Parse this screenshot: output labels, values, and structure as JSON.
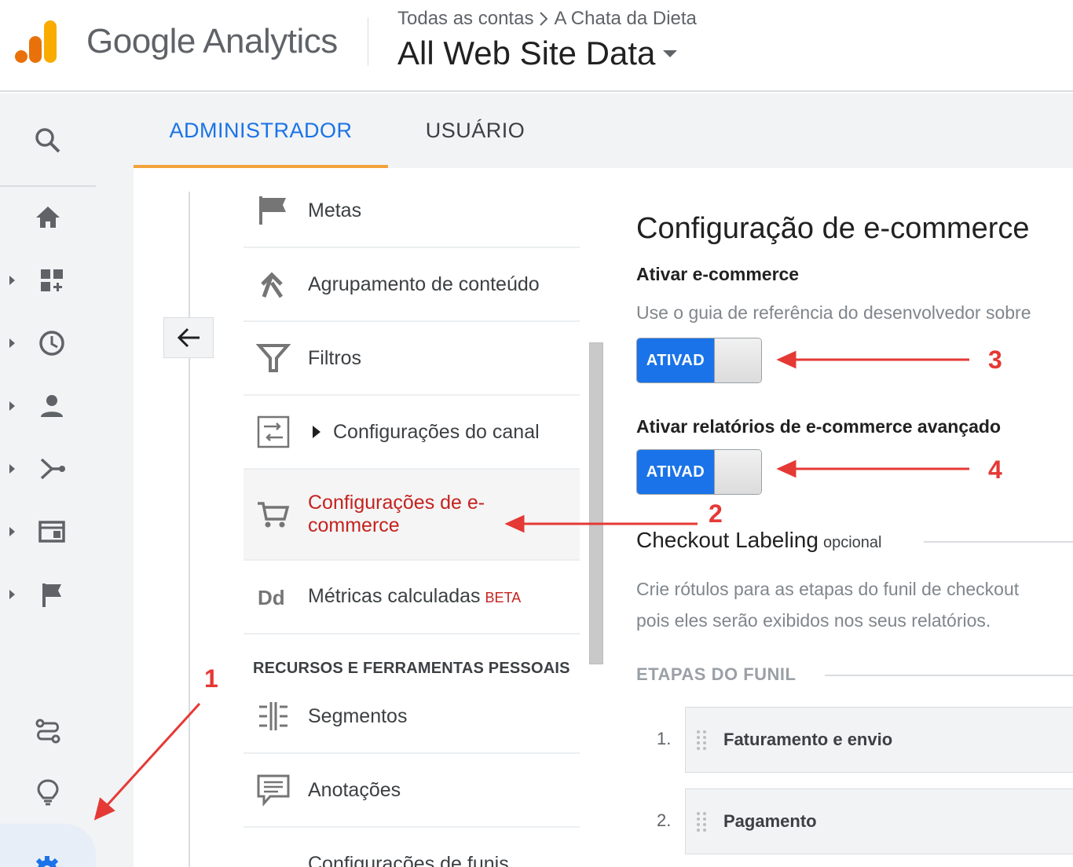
{
  "header": {
    "brand": "Google Analytics",
    "breadcrumb_account": "Todas as contas",
    "breadcrumb_property": "A Chata da Dieta",
    "view_name": "All Web Site Data"
  },
  "tabs": {
    "admin": "ADMINISTRADOR",
    "user": "USUÁRIO"
  },
  "nav": {
    "items": [
      {
        "label": "Metas",
        "icon": "flag-icon"
      },
      {
        "label": "Agrupamento de conteúdo",
        "icon": "content-grouping-icon"
      },
      {
        "label": "Filtros",
        "icon": "filter-icon"
      },
      {
        "label": "Configurações do canal",
        "icon": "channel-settings-icon"
      },
      {
        "label": "Configurações de e-commerce",
        "icon": "cart-icon"
      },
      {
        "label": "Métricas calculadas",
        "badge": "BETA",
        "icon": "calculated-metrics-icon"
      }
    ],
    "section_title": "RECURSOS E FERRAMENTAS PESSOAIS",
    "personal_items": [
      {
        "label": "Segmentos",
        "icon": "segments-icon"
      },
      {
        "label": "Anotações",
        "icon": "annotations-icon"
      },
      {
        "label": "Configurações de funis",
        "icon": "funnel-settings-icon"
      }
    ]
  },
  "panel": {
    "title": "Configuração de e-commerce",
    "enable_ecommerce_label": "Ativar e-commerce",
    "enable_ecommerce_help": "Use o guia de referência do desenvolvedor sobre",
    "toggle_on_label": "ATIVAD",
    "enable_enhanced_label": "Ativar relatórios de e-commerce avançado",
    "checkout_title": "Checkout Labeling",
    "checkout_optional": "opcional",
    "checkout_help_line1": "Crie rótulos para as etapas do funil de checkout",
    "checkout_help_line2": "pois eles serão exibidos nos seus relatórios.",
    "funnel_heading": "ETAPAS DO FUNIL",
    "steps": [
      {
        "number": "1.",
        "label": "Faturamento e envio"
      },
      {
        "number": "2.",
        "label": "Pagamento"
      }
    ]
  },
  "annotations": [
    "1",
    "2",
    "3",
    "4"
  ],
  "colors": {
    "accent_blue": "#1a73e8",
    "tab_underline": "#f4a23b",
    "active_red": "#c5221f",
    "annotation_red": "#e53935",
    "logo_orange_dark": "#e8710a",
    "logo_orange_light": "#f9ab00"
  }
}
